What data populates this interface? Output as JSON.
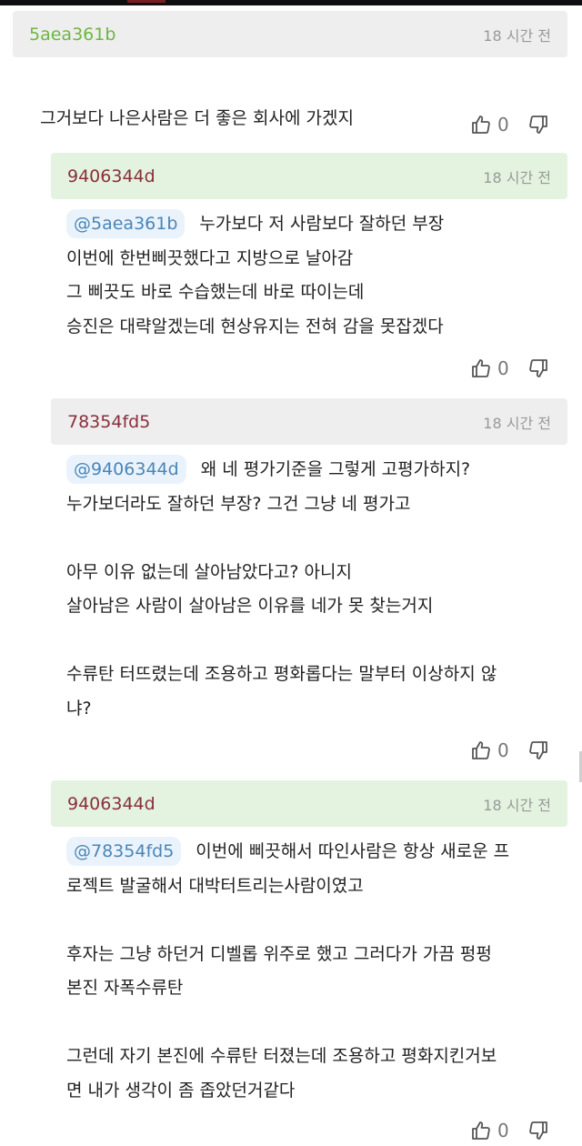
{
  "comments": [
    {
      "author": "5aea361b",
      "time": "18 시간 전",
      "lines": [
        "그거보다 나은사람은 더 좋은 회사에 가겠지"
      ],
      "likes": "0"
    },
    {
      "author": "9406344d",
      "time": "18 시간 전",
      "mention": "@5aea361b",
      "lines": [
        "누가보다 저 사람보다 잘하던 부장",
        "이번에 한번삐끗했다고 지방으로 날아감",
        "그 삐끗도 바로 수습했는데 바로 따이는데",
        "승진은 대략알겠는데 현상유지는 전혀 감을 못잡겠다"
      ],
      "likes": "0"
    },
    {
      "author": "78354fd5",
      "time": "18 시간 전",
      "mention": "@9406344d",
      "lines": [
        "왜 네 평가기준을 그렇게 고평가하지?",
        "누가보더라도 잘하던 부장? 그건 그냥 네 평가고",
        "",
        "아무 이유 없는데 살아남았다고? 아니지",
        "살아남은 사람이 살아남은 이유를 네가 못 찾는거지",
        "",
        "수류탄 터뜨렸는데 조용하고 평화롭다는 말부터 이상하지 않",
        "냐?"
      ],
      "likes": "0"
    },
    {
      "author": "9406344d",
      "time": "18 시간 전",
      "mention": "@78354fd5",
      "lines": [
        "이번에 삐끗해서 따인사람은 항상 새로운 프",
        "로젝트 발굴해서 대박터트리는사람이였고",
        "",
        "후자는 그냥 하던거 디벨롭 위주로 했고 그러다가 가끔 펑펑",
        "본진 자폭수류탄",
        "",
        "그런데 자기 본진에 수류탄 터졌는데 조용하고 평화지킨거보",
        "면 내가 생각이 좀 좁았던거같다"
      ],
      "likes": "0"
    }
  ],
  "colors": {
    "author_green": "#6fb640",
    "author_maroon": "#8a2f3a",
    "mention_text": "#4a86b8",
    "header_gray": "#eeeeee",
    "header_green": "#e3f3df"
  },
  "icons": [
    "thumbs-up-icon",
    "thumbs-down-icon"
  ]
}
